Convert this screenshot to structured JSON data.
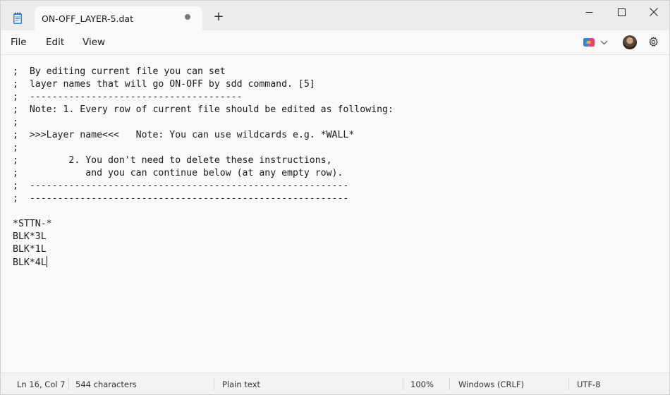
{
  "tab": {
    "title": "ON-OFF_LAYER-5.dat"
  },
  "menu": {
    "file": "File",
    "edit": "Edit",
    "view": "View"
  },
  "editor": {
    "lines": [
      ";  By editing current file you can set",
      ";  layer names that will go ON-OFF by sdd command. [5]",
      ";  --------------------------------------",
      ";  Note: 1. Every row of current file should be edited as following:",
      ";",
      ";  >>>Layer name<<<   Note: You can use wildcards e.g. *WALL*",
      ";",
      ";         2. You don't need to delete these instructions,",
      ";            and you can continue below (at any empty row).",
      ";  ---------------------------------------------------------",
      ";  ---------------------------------------------------------",
      "",
      "*STTN-*",
      "BLK*3L",
      "BLK*1L",
      "BLK*4L"
    ]
  },
  "status": {
    "position": "Ln 16, Col 7",
    "characters": "544 characters",
    "format": "Plain text",
    "zoom": "100%",
    "line_ending": "Windows (CRLF)",
    "encoding": "UTF-8"
  },
  "icons": {
    "app": "notepad-icon",
    "new_tab": "plus-icon",
    "minimize": "minimize-icon",
    "maximize": "maximize-icon",
    "close": "close-icon",
    "copilot": "copilot-icon",
    "dropdown": "chevron-down-icon",
    "settings": "gear-icon"
  },
  "colors": {
    "accent": "#2b6fd6",
    "text": "#1a1a1a",
    "titlebar": "#ececec",
    "editor_bg": "#f9f9f9"
  }
}
